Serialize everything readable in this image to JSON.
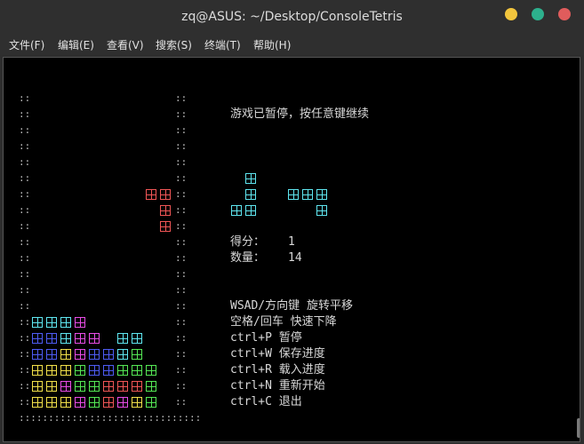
{
  "window": {
    "title": "zq@ASUS: ~/Desktop/ConsoleTetris"
  },
  "menu": [
    {
      "label": "文件(F)"
    },
    {
      "label": "编辑(E)"
    },
    {
      "label": "查看(V)"
    },
    {
      "label": "搜索(S)"
    },
    {
      "label": "终端(T)"
    },
    {
      "label": "帮助(H)"
    }
  ],
  "game": {
    "status": "游戏已暂停，按任意键继续",
    "score_label": "得分：",
    "score_value": "1",
    "count_label": "数量：",
    "count_value": "14",
    "help": [
      {
        "key": "WSAD/方向键",
        "desc": "旋转平移"
      },
      {
        "key": "空格/回车",
        "desc": "快速下降"
      },
      {
        "key": "ctrl+P",
        "desc": "暂停"
      },
      {
        "key": "ctrl+W",
        "desc": "保存进度"
      },
      {
        "key": "ctrl+R",
        "desc": "载入进度"
      },
      {
        "key": "ctrl+N",
        "desc": "重新开始"
      },
      {
        "key": "ctrl+C",
        "desc": "退出"
      }
    ],
    "colors": {
      "cyan": "#5fe6f0",
      "red": "#f05656",
      "blue": "#4e5cf4",
      "magenta": "#e84ce6",
      "yellow": "#f2e04a",
      "green": "#55e855"
    },
    "board": [
      "..........",
      "..........",
      "..........",
      "..........",
      "..........",
      "..........",
      "........RR",
      ".........R",
      ".........R",
      "..........",
      "..........",
      "..........",
      "..........",
      "..........",
      "CCCM......",
      "BBCMM.CC..",
      "BBYMBBCG..",
      "YYYGBBGGG.",
      "YYMGGRRRG.",
      "YYYMGRMYG."
    ],
    "next_pieces": [
      {
        "color": "C",
        "cells": [
          [
            1,
            0
          ],
          [
            1,
            1
          ],
          [
            0,
            2
          ],
          [
            1,
            2
          ]
        ]
      },
      {
        "color": "C",
        "cells": [
          [
            0,
            0
          ],
          [
            1,
            0
          ],
          [
            2,
            0
          ],
          [
            2,
            1
          ]
        ]
      }
    ]
  }
}
